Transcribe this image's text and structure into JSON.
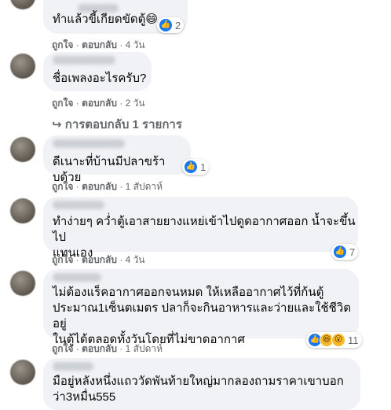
{
  "actions": {
    "like": "ถูกใจ",
    "reply": "ตอบกลับ",
    "sep": "·"
  },
  "comments": [
    {
      "text": "ทำแล้วขี้เกียดขัดตู้",
      "emoji": "😄",
      "time": "4 วัน",
      "reactions": "2",
      "reaction_icons": [
        "like-icon"
      ]
    },
    {
      "text": "ชื่อเพลงอะไรครับ?",
      "time": "2 วัน"
    },
    {
      "text": "ดีเนาะที่บ้านมีปลาขร้าบด้วย",
      "time": "1 สัปดาห์",
      "reactions": "1",
      "reaction_icons": [
        "like-icon"
      ]
    },
    {
      "text": "ทำง่ายๆ คว่ำตู้เอาสายยางแหย่เข้าไปดูดอากาศออก น้ำจะขึ้นไป\nแทนเอง",
      "time": "4 วัน",
      "reactions": "7",
      "reaction_icons": [
        "like-icon"
      ]
    },
    {
      "text": "ไม่ต้องแร็คอากาศออกจนหมด ให้เหลืออากาศไว้ที่ก้นตู้\nประมาณ1เซ็นตเมตร ปลาก็จะกินอาหารและว่ายและใช้ชีวิตอยู่\nในตู้ได้ตลอดทั้งวันโดยที่ไม่ขาดอากาศ",
      "time": "1 สัปดาห์",
      "reactions": "11",
      "reaction_icons": [
        "like-icon",
        "haha-icon",
        "wow-icon"
      ]
    },
    {
      "text": "มือยู่หลังหนึ่งแถววัดพันท้ายใหญ่มากลองถามราคาเขาบอก\nว่า3หมื่น555"
    }
  ],
  "replies_link": {
    "arrow": "↪",
    "label": "การตอบกลับ 1 รายการ"
  },
  "colors": {
    "bubble": "#f0f2f5",
    "secondary_text": "#65676b",
    "like_blue": "#1877f2"
  }
}
